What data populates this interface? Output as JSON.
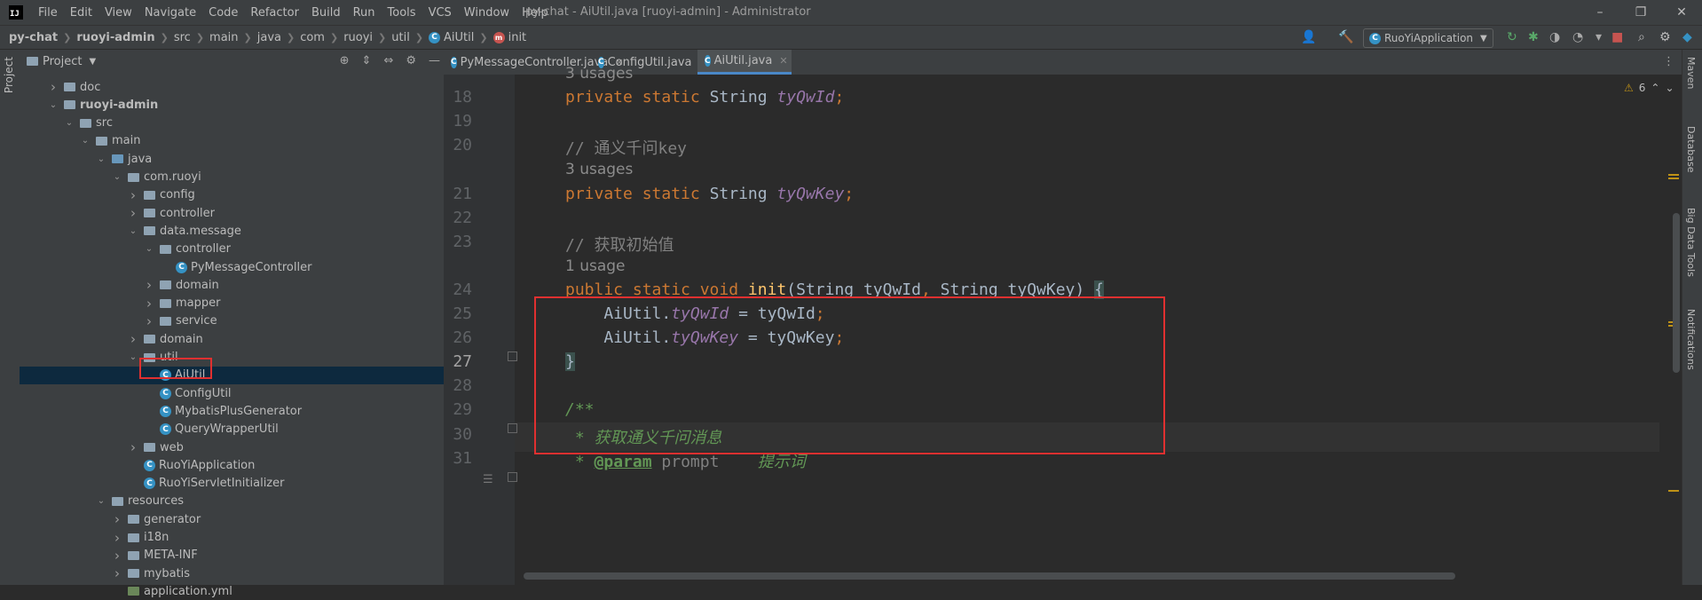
{
  "window": {
    "title": "py-chat - AiUtil.java [ruoyi-admin] - Administrator",
    "menu": [
      "File",
      "Edit",
      "View",
      "Navigate",
      "Code",
      "Refactor",
      "Build",
      "Run",
      "Tools",
      "VCS",
      "Window",
      "Help"
    ],
    "controls": [
      "–",
      "❐",
      "✕"
    ]
  },
  "breadcrumb": [
    "py-chat",
    "ruoyi-admin",
    "src",
    "main",
    "java",
    "com",
    "ruoyi",
    "util",
    "AiUtil",
    "init"
  ],
  "run_config": "RuoYiApplication",
  "project_panel": {
    "title": "Project",
    "tool_window_label": "Project",
    "tree": [
      {
        "label": "doc",
        "type": "folder",
        "depth": 1,
        "expanded": false
      },
      {
        "label": "ruoyi-admin",
        "type": "module",
        "depth": 1,
        "expanded": true,
        "bold": true
      },
      {
        "label": "src",
        "type": "folder",
        "depth": 2,
        "expanded": true
      },
      {
        "label": "main",
        "type": "folder",
        "depth": 3,
        "expanded": true
      },
      {
        "label": "java",
        "type": "src",
        "depth": 4,
        "expanded": true
      },
      {
        "label": "com.ruoyi",
        "type": "package",
        "depth": 5,
        "expanded": true
      },
      {
        "label": "config",
        "type": "package",
        "depth": 6,
        "expanded": false
      },
      {
        "label": "controller",
        "type": "package",
        "depth": 6,
        "expanded": false
      },
      {
        "label": "data.message",
        "type": "package",
        "depth": 6,
        "expanded": true
      },
      {
        "label": "controller",
        "type": "package",
        "depth": 7,
        "expanded": true
      },
      {
        "label": "PyMessageController",
        "type": "class",
        "depth": 8
      },
      {
        "label": "domain",
        "type": "package",
        "depth": 7,
        "expanded": false
      },
      {
        "label": "mapper",
        "type": "package",
        "depth": 7,
        "expanded": false
      },
      {
        "label": "service",
        "type": "package",
        "depth": 7,
        "expanded": false
      },
      {
        "label": "domain",
        "type": "package",
        "depth": 6,
        "expanded": false
      },
      {
        "label": "util",
        "type": "package",
        "depth": 6,
        "expanded": true
      },
      {
        "label": "AiUtil",
        "type": "class",
        "depth": 7,
        "selected": true
      },
      {
        "label": "ConfigUtil",
        "type": "class",
        "depth": 7
      },
      {
        "label": "MybatisPlusGenerator",
        "type": "class",
        "depth": 7
      },
      {
        "label": "QueryWrapperUtil",
        "type": "class",
        "depth": 7
      },
      {
        "label": "web",
        "type": "package",
        "depth": 6,
        "expanded": false
      },
      {
        "label": "RuoYiApplication",
        "type": "class-run",
        "depth": 6
      },
      {
        "label": "RuoYiServletInitializer",
        "type": "class",
        "depth": 6
      },
      {
        "label": "resources",
        "type": "folder",
        "depth": 4,
        "expanded": true
      },
      {
        "label": "generator",
        "type": "folder",
        "depth": 5,
        "expanded": false
      },
      {
        "label": "i18n",
        "type": "folder",
        "depth": 5,
        "expanded": false
      },
      {
        "label": "META-INF",
        "type": "folder",
        "depth": 5,
        "expanded": false
      },
      {
        "label": "mybatis",
        "type": "folder",
        "depth": 5,
        "expanded": false
      },
      {
        "label": "application.yml",
        "type": "file",
        "depth": 5
      }
    ]
  },
  "tabs": [
    {
      "label": "PyMessageController.java",
      "active": false
    },
    {
      "label": "ConfigUtil.java",
      "active": false
    },
    {
      "label": "AiUtil.java",
      "active": true
    }
  ],
  "inspections": {
    "warnings": "6"
  },
  "right_tools": [
    "Maven",
    "Database",
    "Big Data Tools",
    "Notifications"
  ],
  "editor": {
    "current_line": "27",
    "lines": [
      {
        "usage": "3 usages"
      },
      {
        "num": "18",
        "tokens": [
          [
            "kw",
            "private static "
          ],
          [
            "plain",
            "String "
          ],
          [
            "fld",
            "tyQwId"
          ],
          [
            "kw",
            ";"
          ]
        ]
      },
      {
        "num": "19",
        "tokens": []
      },
      {
        "num": "20",
        "tokens": [
          [
            "cmt",
            "// 通义千问key"
          ]
        ]
      },
      {
        "usage": "3 usages"
      },
      {
        "num": "21",
        "tokens": [
          [
            "kw",
            "private static "
          ],
          [
            "plain",
            "String "
          ],
          [
            "fld",
            "tyQwKey"
          ],
          [
            "kw",
            ";"
          ]
        ]
      },
      {
        "num": "22",
        "tokens": []
      },
      {
        "num": "23",
        "tokens": [
          [
            "cmt",
            "// 获取初始值"
          ]
        ]
      },
      {
        "usage": "1 usage"
      },
      {
        "num": "24",
        "tokens": [
          [
            "kw",
            "public static void "
          ],
          [
            "fn",
            "init"
          ],
          [
            "plain",
            "(String tyQwId"
          ],
          [
            "kw",
            ", "
          ],
          [
            "plain",
            "String tyQwKey) "
          ],
          [
            "brace",
            "{"
          ]
        ]
      },
      {
        "num": "25",
        "tokens": [
          [
            "plain",
            "    AiUtil."
          ],
          [
            "fld",
            "tyQwId"
          ],
          [
            "plain",
            " = tyQwId"
          ],
          [
            "kw",
            ";"
          ]
        ]
      },
      {
        "num": "26",
        "tokens": [
          [
            "plain",
            "    AiUtil."
          ],
          [
            "fld",
            "tyQwKey"
          ],
          [
            "plain",
            " = tyQwKey"
          ],
          [
            "kw",
            ";"
          ]
        ]
      },
      {
        "num": "27",
        "tokens": [
          [
            "brace",
            "}"
          ]
        ]
      },
      {
        "num": "28",
        "tokens": []
      },
      {
        "num": "29",
        "tokens": [
          [
            "doc",
            "/**"
          ]
        ]
      },
      {
        "num": "30",
        "tokens": [
          [
            "doc",
            " * 获取通义千问消息"
          ]
        ]
      },
      {
        "num": "31",
        "tokens": [
          [
            "doc",
            " * "
          ],
          [
            "tag",
            "@param"
          ],
          [
            "doc",
            " "
          ],
          [
            "param",
            "prompt"
          ],
          [
            "doc",
            "    提示词"
          ]
        ]
      }
    ]
  },
  "colors": {
    "highlight_box": "#e03030",
    "selection": "#0d293e"
  }
}
